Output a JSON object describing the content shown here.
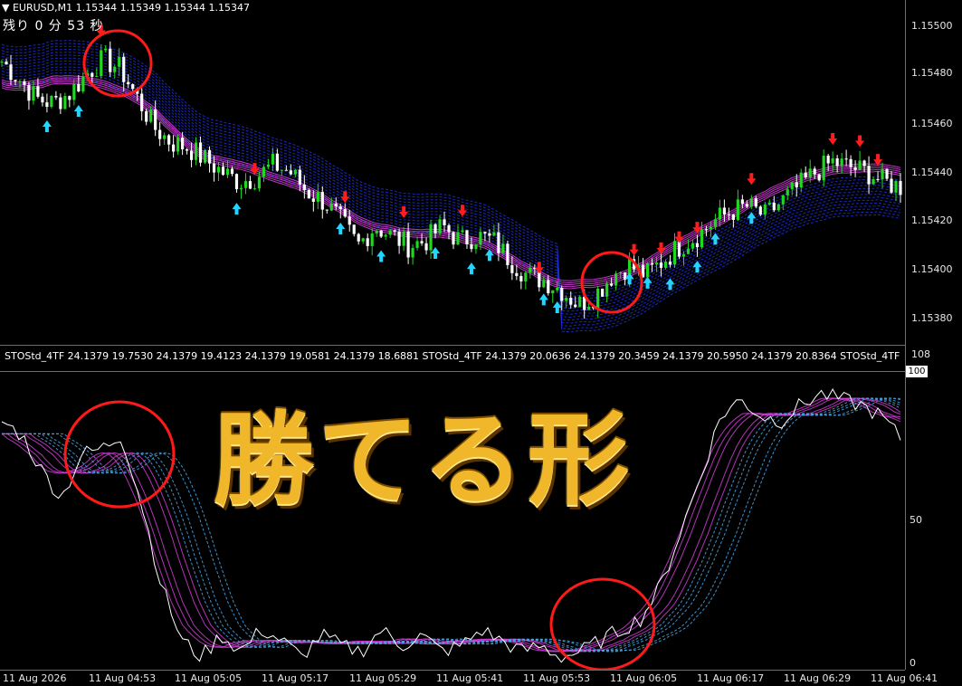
{
  "chart_header": {
    "symbol_line": "▼ EURUSD,M1  1.15344 1.15349 1.15344 1.15347",
    "countdown": "残り 0 分 53 秒"
  },
  "indicator_header": {
    "text": "STOStd_4TF 24.1379 19.7530 24.1379 19.4123 24.1379 19.0581 24.1379 18.6881   STOStd_4TF 24.1379 20.0636 24.1379 20.3459 24.1379 20.5950 24.1379 20.8364  STOStd_4TF"
  },
  "overlay_title": "勝てる形",
  "colors": {
    "background": "#000000",
    "bull_candle": "#1fd81f",
    "bear_candle": "#ffffff",
    "up_arrow": "#23d4ff",
    "down_arrow": "#ff1c1c",
    "ribbon_magenta": "#d23cd8",
    "ribbon_blue": "#2030d8",
    "circle": "#ff1a1a"
  },
  "price_axis": [
    "1.15500",
    "1.15480",
    "1.15460",
    "1.15440",
    "1.15420",
    "1.15400",
    "1.15380"
  ],
  "osc_axis": [
    "108",
    "100",
    "50",
    "0"
  ],
  "time_axis": [
    "11 Aug 2026",
    "11 Aug 04:53",
    "11 Aug 05:05",
    "11 Aug 05:17",
    "11 Aug 05:29",
    "11 Aug 05:41",
    "11 Aug 05:53",
    "11 Aug 06:05",
    "11 Aug 06:17",
    "11 Aug 06:29",
    "11 Aug 06:41"
  ],
  "chart_data": [
    {
      "type": "candlestick",
      "title": "EURUSD,M1",
      "ylim": [
        1.1537,
        1.1551
      ],
      "close_approx": [
        1.15485,
        1.15478,
        1.1547,
        1.15468,
        1.15472,
        1.1548,
        1.15486,
        1.15482,
        1.1547,
        1.15458,
        1.15452,
        1.1545,
        1.15445,
        1.1544,
        1.15436,
        1.15438,
        1.15443,
        1.1544,
        1.15432,
        1.15428,
        1.1542,
        1.1541,
        1.15418,
        1.15414,
        1.1541,
        1.15412,
        1.15418,
        1.15412,
        1.15414,
        1.15412,
        1.15404,
        1.15398,
        1.15396,
        1.15392,
        1.15386,
        1.1539,
        1.15398,
        1.15402,
        1.15398,
        1.15404,
        1.1541,
        1.15414,
        1.1542,
        1.15424,
        1.15426,
        1.15422,
        1.15428,
        1.15434,
        1.1544,
        1.15444,
        1.15442,
        1.1544,
        1.15436,
        1.15434
      ],
      "up_arrows": 16,
      "down_arrows": 14
    },
    {
      "type": "line",
      "title": "STOStd_4TF",
      "ylim": [
        0,
        108
      ],
      "main_line_approx": [
        90,
        85,
        72,
        62,
        78,
        80,
        85,
        60,
        30,
        10,
        4,
        12,
        6,
        14,
        10,
        4,
        12,
        8,
        6,
        14,
        8,
        12,
        6,
        8,
        14,
        10,
        6,
        8,
        4,
        6,
        10,
        14,
        18,
        30,
        50,
        70,
        92,
        98,
        92,
        90,
        96,
        100,
        98,
        96,
        92,
        84
      ]
    }
  ]
}
